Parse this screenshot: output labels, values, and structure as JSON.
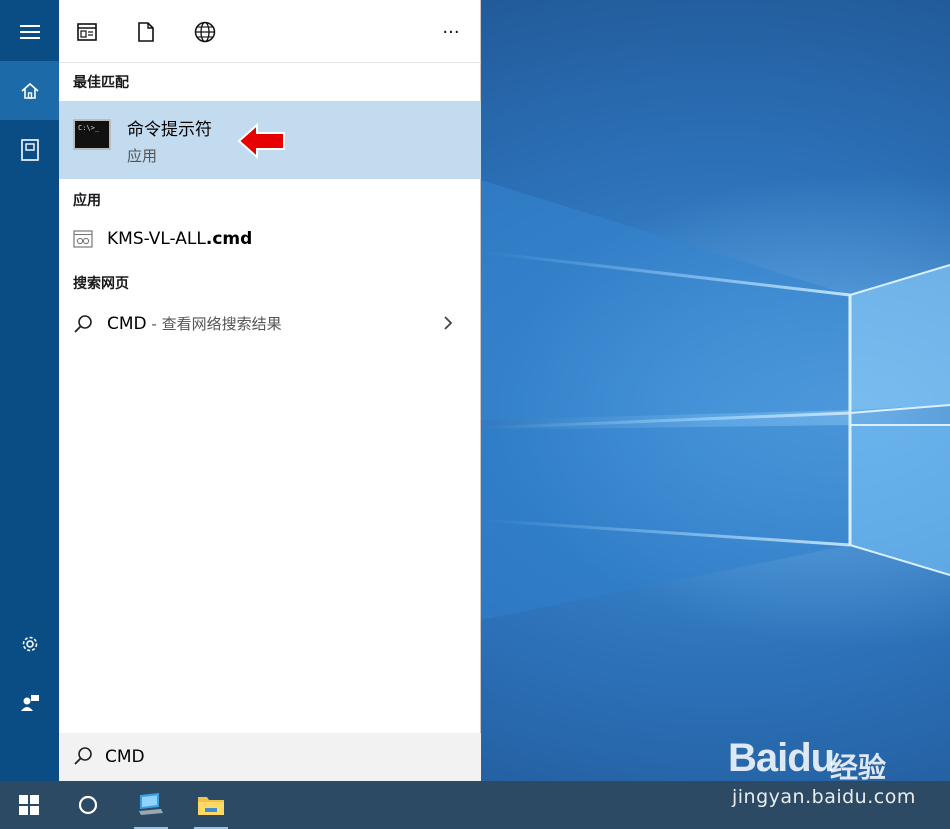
{
  "start_menu": {
    "rail": {
      "items": [
        {
          "icon": "hamburger-menu-icon"
        },
        {
          "icon": "home-icon"
        },
        {
          "icon": "notebook-icon"
        },
        {
          "icon": "gear-icon"
        },
        {
          "icon": "feedback-icon"
        }
      ]
    },
    "toolbar": {
      "icons": [
        "apps-filter-icon",
        "documents-filter-icon",
        "web-filter-icon"
      ],
      "more_label": "···"
    },
    "best_match": {
      "section_label": "最佳匹配",
      "title": "命令提示符",
      "subtitle": "应用",
      "icon_text": "C:\\>_"
    },
    "apps": {
      "section_label": "应用",
      "item_name": "KMS-VL-ALL",
      "item_ext": ".cmd"
    },
    "web": {
      "section_label": "搜索网页",
      "query": "CMD",
      "hint": " - 查看网络搜索结果"
    },
    "search": {
      "value": "CMD"
    }
  },
  "taskbar": {
    "icons": [
      "windows-start-icon",
      "cortana-circle-icon",
      "this-pc-icon",
      "file-explorer-icon"
    ]
  },
  "watermark": {
    "brand": "Baidu",
    "sub": "经验",
    "url": "jingyan.baidu.com"
  },
  "colors": {
    "rail": "#0a4d84",
    "highlight": "#c2dbef",
    "taskbar": "#2c4a63",
    "arrow": "#e60000"
  }
}
